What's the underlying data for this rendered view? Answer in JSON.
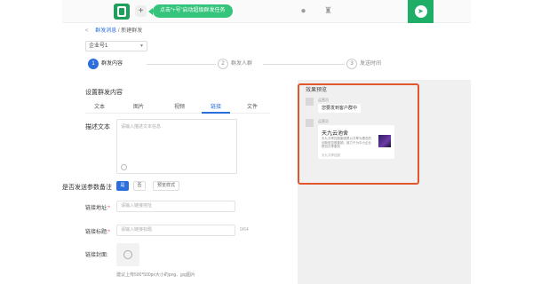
{
  "topbar": {
    "plus": "+",
    "pill_text": "点击“+号”启动超级群发任务",
    "icons": [
      "chat-bubble-icon",
      "medal-icon",
      "send-icon"
    ]
  },
  "breadcrumb": {
    "back": "<",
    "parent": "群发消息",
    "separator": "/",
    "current": "新建群发"
  },
  "account_select": {
    "value": "企业号1"
  },
  "steps": [
    {
      "num": "1",
      "label": "群发内容"
    },
    {
      "num": "2",
      "label": "群发人群"
    },
    {
      "num": "3",
      "label": "发送时间"
    }
  ],
  "content": {
    "section_title": "设置群发内容",
    "tabs": [
      "文本",
      "图片",
      "视频",
      "链接",
      "文件"
    ],
    "active_tab": "链接",
    "desc_label": "描述文本",
    "desc_placeholder": "请输入描述文本信息",
    "toggle_label": "是否发送参数备注",
    "toggle_options": [
      "是",
      "否"
    ],
    "toggle_selected": "是",
    "preview_button": "预览样式",
    "link_url_label": "链接地址:",
    "link_url_placeholder": "请输入链接地址",
    "link_title_label": "链接标题:",
    "link_title_placeholder": "请输入链接标题",
    "title_counter": "0/64",
    "cover_label": "链接封面:",
    "cover_hint": "建议上传500*500px大小的png、jpg图片"
  },
  "preview": {
    "title": "效果预览",
    "sender_1": "运营员",
    "bubble_text": "您要发到客户群中",
    "sender_2": "运营员",
    "card": {
      "title": "天九云池舍",
      "desc": "天九共享控股集团是以共享为理念的创新型控股集团，致力于为中小企业提供共享服务",
      "foot": "天九共享控股"
    }
  }
}
